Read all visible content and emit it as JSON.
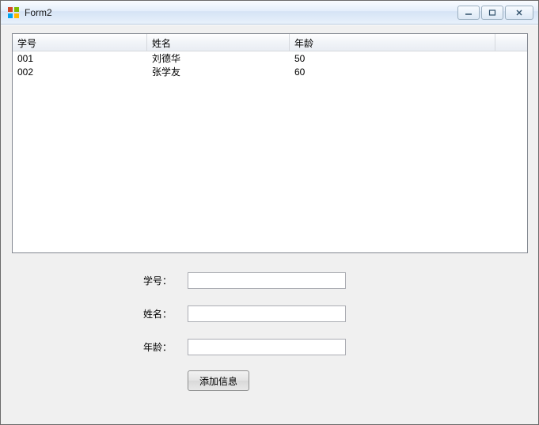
{
  "window": {
    "title": "Form2"
  },
  "listview": {
    "columns": [
      "学号",
      "姓名",
      "年龄"
    ],
    "rows": [
      {
        "id": "001",
        "name": "刘德华",
        "age": "50"
      },
      {
        "id": "002",
        "name": "张学友",
        "age": "60"
      }
    ]
  },
  "form": {
    "labels": {
      "id": "学号：",
      "name": "姓名：",
      "age": "年龄："
    },
    "values": {
      "id": "",
      "name": "",
      "age": ""
    },
    "submit_label": "添加信息"
  }
}
